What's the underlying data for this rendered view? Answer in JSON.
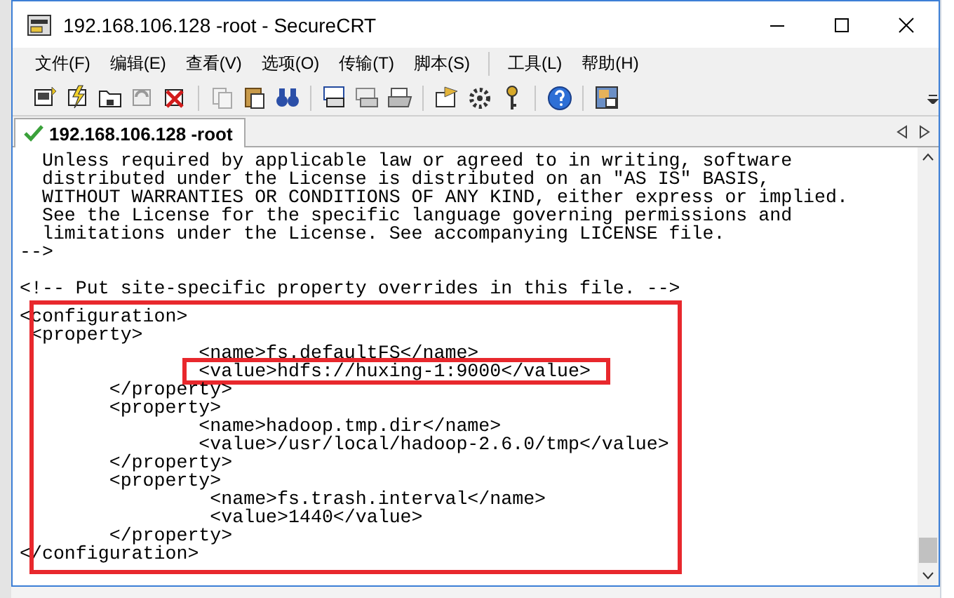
{
  "window": {
    "title": "192.168.106.128 -root - SecureCRT"
  },
  "menu": [
    {
      "label": "文件(F)",
      "separator_before": false
    },
    {
      "label": "编辑(E)",
      "separator_before": false
    },
    {
      "label": "查看(V)",
      "separator_before": false
    },
    {
      "label": "选项(O)",
      "separator_before": false
    },
    {
      "label": "传输(T)",
      "separator_before": false
    },
    {
      "label": "脚本(S)",
      "separator_before": false
    },
    {
      "label": "工具(L)",
      "separator_before": true
    },
    {
      "label": "帮助(H)",
      "separator_before": false
    }
  ],
  "tabs": [
    {
      "label": "192.168.106.128 -root",
      "selected": true,
      "connected": true
    }
  ],
  "terminal": {
    "lines": [
      {
        "kind": "text",
        "text": "  Unless required by applicable law or agreed to in writing, software"
      },
      {
        "kind": "text",
        "text": "  distributed under the License is distributed on an \"AS IS\" BASIS,"
      },
      {
        "kind": "text",
        "text": "  WITHOUT WARRANTIES OR CONDITIONS OF ANY KIND, either express or implied."
      },
      {
        "kind": "text",
        "text": "  See the License for the specific language governing permissions and"
      },
      {
        "kind": "text",
        "text": "  limitations under the License. See accompanying LICENSE file."
      },
      {
        "kind": "text",
        "text": "-->"
      },
      {
        "kind": "blank"
      },
      {
        "kind": "text",
        "text": "<!-- Put site-specific property overrides in this file. -->"
      }
    ],
    "block": {
      "highlighted": true,
      "lines": [
        {
          "text": "<configuration>",
          "highlighted": false
        },
        {
          "text": " <property>",
          "highlighted": false
        },
        {
          "text": "                <name>fs.defaultFS</name>",
          "highlighted": false
        },
        {
          "text": "                <value>hdfs://huxing-1:9000</value>",
          "highlighted": true
        },
        {
          "text": "        </property>",
          "highlighted": false
        },
        {
          "text": "        <property>",
          "highlighted": false
        },
        {
          "text": "                <name>hadoop.tmp.dir</name>",
          "highlighted": false
        },
        {
          "text": "                <value>/usr/local/hadoop-2.6.0/tmp</value>",
          "highlighted": false
        },
        {
          "text": "        </property>",
          "highlighted": false
        },
        {
          "text": "        <property>",
          "highlighted": false
        },
        {
          "text": "                 <name>fs.trash.interval</name>",
          "highlighted": false
        },
        {
          "text": "                 <value>1440</value>",
          "highlighted": false
        },
        {
          "text": "        </property>",
          "highlighted": false
        },
        {
          "text": "</configuration>",
          "highlighted": false
        }
      ]
    }
  }
}
